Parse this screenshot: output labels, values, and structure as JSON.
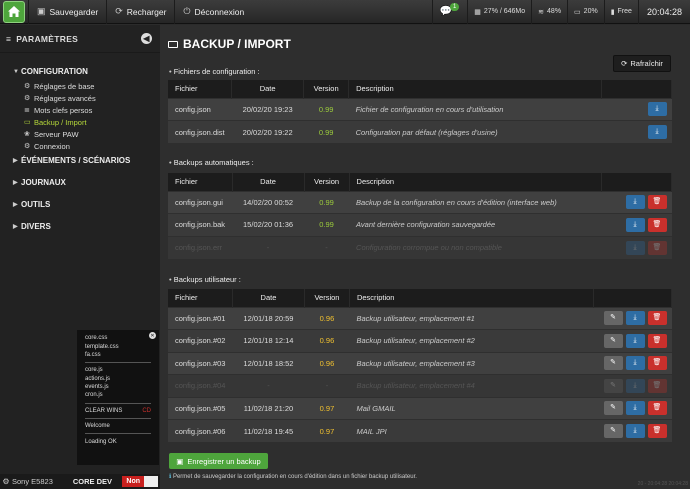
{
  "topbar": {
    "save": "Sauvegarder",
    "reload": "Recharger",
    "logout": "Déconnexion",
    "notif_count": "1",
    "memory": "27% / 646Mo",
    "wifi": "48%",
    "battery": "20%",
    "network": "Free",
    "time": "20:04:28"
  },
  "sidebar": {
    "header": "PARAMÈTRES",
    "configuration": "CONFIGURATION",
    "items": [
      {
        "label": "Réglages de base",
        "icon": "gears-icon"
      },
      {
        "label": "Réglages avancés",
        "icon": "gears-icon"
      },
      {
        "label": "Mots clefs persos",
        "icon": "list-icon"
      },
      {
        "label": "Backup / Import",
        "icon": "hdd-icon"
      },
      {
        "label": "Serveur PAW",
        "icon": "paw-icon"
      },
      {
        "label": "Connexion",
        "icon": "gear-icon"
      }
    ],
    "events": "ÉVÉNEMENTS / SCÉNARIOS",
    "journaux": "JOURNAUX",
    "outils": "OUTILS",
    "divers": "DIVERS"
  },
  "debug": {
    "css": [
      "core.css",
      "template.css",
      "fa.css"
    ],
    "js": [
      "core.js",
      "actions.js",
      "events.js",
      "cron.js"
    ],
    "clear": "CLEAR WINS",
    "clear_tag": "CD",
    "welcome": "Welcome",
    "loading": "Loading OK"
  },
  "bottom": {
    "device": "Sony E5823",
    "dev": "CORE DEV",
    "toggle": "Non"
  },
  "main": {
    "title": "BACKUP / IMPORT",
    "refresh": "Rafraîchir",
    "headers": {
      "file": "Fichier",
      "date": "Date",
      "version": "Version",
      "description": "Description"
    },
    "config_title": "Fichiers de configuration :",
    "config_rows": [
      {
        "file": "config.json",
        "date": "20/02/20 19:23",
        "version": "0.99",
        "description": "Fichier de configuration en cours d'utilisation"
      },
      {
        "file": "config.json.dist",
        "date": "20/02/20 19:22",
        "version": "0.99",
        "description": "Configuration par défaut (réglages d'usine)"
      }
    ],
    "auto_title": "Backups automatiques :",
    "auto_rows": [
      {
        "file": "config.json.gui",
        "date": "14/02/20 00:52",
        "version": "0.99",
        "description": "Backup de la configuration en cours d'édition (interface web)"
      },
      {
        "file": "config.json.bak",
        "date": "15/02/20 01:36",
        "version": "0.99",
        "description": "Avant dernière configuration sauvegardée"
      },
      {
        "file": "config.json.err",
        "date": "-",
        "version": "-",
        "description": "Configuration corrompue ou non compatible"
      }
    ],
    "user_title": "Backups utilisateur :",
    "user_rows": [
      {
        "file": "config.json.#01",
        "date": "12/01/18 20:59",
        "version": "0.96",
        "description": "Backup utilisateur, emplacement #1"
      },
      {
        "file": "config.json.#02",
        "date": "12/01/18 12:14",
        "version": "0.96",
        "description": "Backup utilisateur, emplacement #2"
      },
      {
        "file": "config.json.#03",
        "date": "12/01/18 18:52",
        "version": "0.96",
        "description": "Backup utilisateur, emplacement #3"
      },
      {
        "file": "config.json.#04",
        "date": "-",
        "version": "-",
        "description": "Backup utilisateur, emplacement #4"
      },
      {
        "file": "config.json.#05",
        "date": "11/02/18 21:20",
        "version": "0.97",
        "description": "Mail GMAIL"
      },
      {
        "file": "config.json.#06",
        "date": "11/02/18 19:45",
        "version": "0.97",
        "description": "MAIL JPI"
      }
    ],
    "save_button": "Enregistrer un backup",
    "help": "Permet de sauvegarder la configuration en cours d'édition dans un fichier backup utilisateur.",
    "footer_timestamp": "20 - 20:04:28 20:04:28"
  },
  "colors": {
    "accent": "#4ea53c",
    "active": "#b6d93a",
    "download": "#2e6da4",
    "delete": "#c9302c"
  }
}
